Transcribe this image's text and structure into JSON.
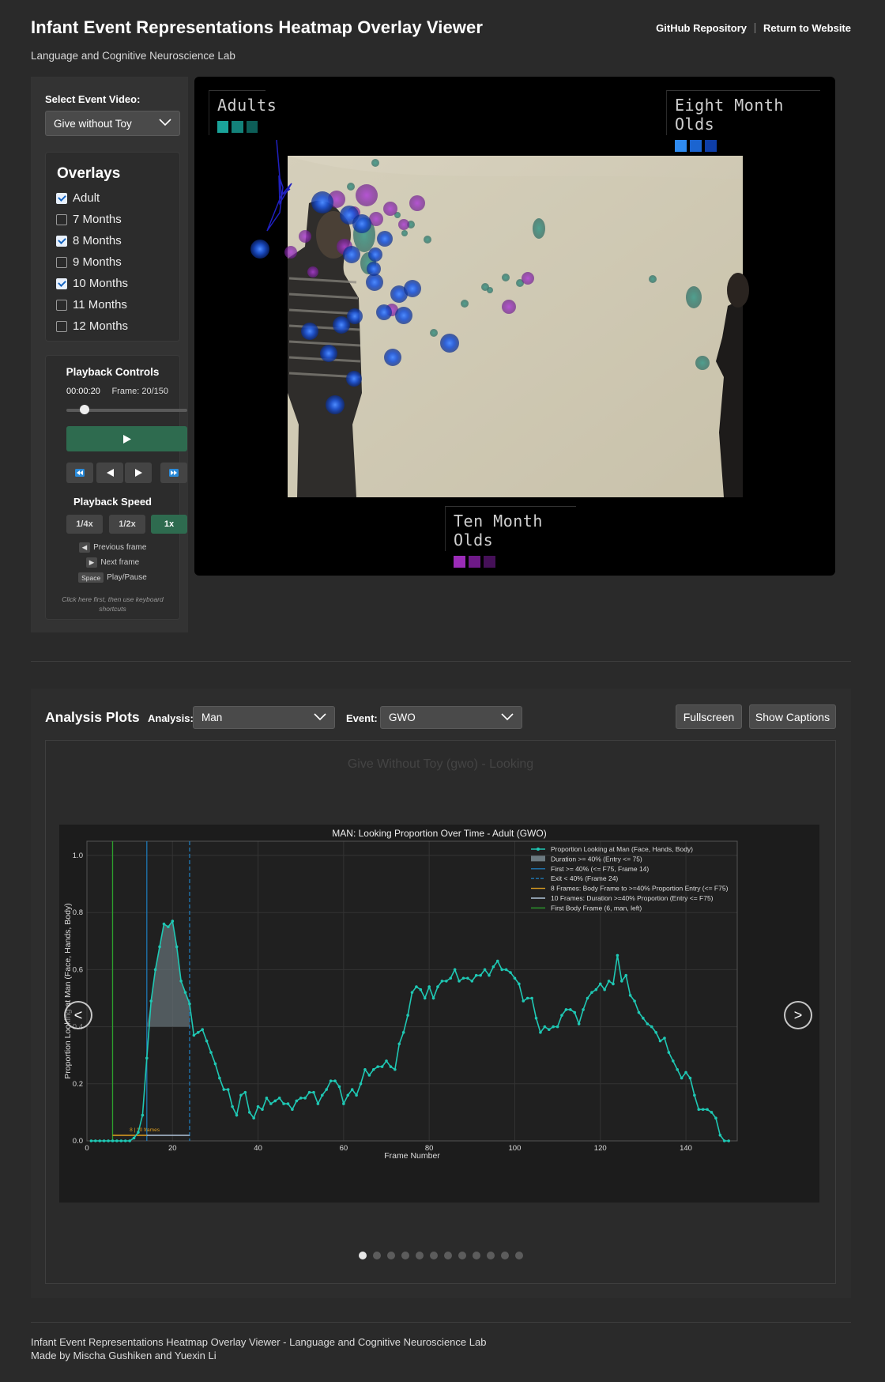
{
  "header": {
    "title": "Infant Event Representations Heatmap Overlay Viewer",
    "subtitle": "Language and Cognitive Neuroscience Lab",
    "links": [
      "GitHub Repository",
      "Return to Website"
    ]
  },
  "sidebar": {
    "select_label": "Select Event Video:",
    "selected_video": "Give without Toy",
    "overlays_title": "Overlays",
    "overlays": [
      {
        "label": "Adult",
        "checked": true
      },
      {
        "label": "7 Months",
        "checked": false
      },
      {
        "label": "8 Months",
        "checked": true
      },
      {
        "label": "9 Months",
        "checked": false
      },
      {
        "label": "10 Months",
        "checked": true
      },
      {
        "label": "11 Months",
        "checked": false
      },
      {
        "label": "12 Months",
        "checked": false
      }
    ],
    "playback": {
      "title": "Playback Controls",
      "time": "00:00:20",
      "frame": "Frame: 20/150",
      "progress": 0.133,
      "speed_title": "Playback Speed",
      "speeds": [
        "1/4x",
        "1/2x",
        "1x"
      ],
      "active_speed": "1x",
      "shortcuts": [
        {
          "key": "◀",
          "label": "Previous frame"
        },
        {
          "key": "▶",
          "label": "Next frame"
        },
        {
          "key": "Space",
          "label": "Play/Pause"
        }
      ],
      "note": "Click here first, then use keyboard shortcuts"
    }
  },
  "video": {
    "legends": [
      {
        "name": "Adults",
        "colors": [
          "#1aa39a",
          "#13827a",
          "#0d5e58"
        ]
      },
      {
        "name": "Eight Month Olds",
        "colors": [
          "#2f8bf0",
          "#1b64d0",
          "#0e3ea8"
        ]
      },
      {
        "name": "Ten Month Olds",
        "colors": [
          "#9b2cb8",
          "#6e1a88",
          "#451058"
        ]
      }
    ]
  },
  "analysis": {
    "title": "Analysis Plots",
    "analysis_label": "Analysis:",
    "analysis_value": "Man",
    "event_label": "Event:",
    "event_value": "GWO",
    "fullscreen": "Fullscreen",
    "captions": "Show Captions",
    "faded_title": "Give Without Toy (gwo) - Looking",
    "dot_count": 12,
    "active_dot": 0,
    "prev": "<",
    "next": ">"
  },
  "chart_data": {
    "type": "line",
    "title": "MAN: Looking Proportion Over Time - Adult (GWO)",
    "xlabel": "Frame Number",
    "ylabel": "Proportion Looking at Man (Face, Hands, Body)",
    "xlim": [
      0,
      152
    ],
    "ylim": [
      0,
      1.05
    ],
    "xticks": [
      0,
      20,
      40,
      60,
      80,
      100,
      120,
      140
    ],
    "yticks": [
      0.0,
      0.2,
      0.4,
      0.6,
      0.8,
      1.0
    ],
    "grid": true,
    "legend_position": "top-right",
    "legend": [
      "Proportion Looking at Man (Face, Hands, Body)",
      "Duration >= 40% (Entry <= 75)",
      "First >= 40% (<= F75, Frame 14)",
      "Exit < 40% (Frame 24)",
      "8 Frames: Body Frame to >=40% Proportion Entry (<= F75)",
      "10 Frames: Duration >=40% Proportion (Entry <= F75)",
      "First Body Frame (6, man, left)"
    ],
    "annotation": "8 | 10 frames",
    "vlines": [
      {
        "x": 6,
        "color": "#2ca02c",
        "style": "solid"
      },
      {
        "x": 14,
        "color": "#1f77b4",
        "style": "solid"
      },
      {
        "x": 24,
        "color": "#1f77b4",
        "style": "dashed"
      }
    ],
    "series": [
      {
        "name": "Proportion Looking at Man (Face, Hands, Body)",
        "x": [
          1,
          2,
          3,
          4,
          5,
          6,
          7,
          8,
          9,
          10,
          11,
          12,
          13,
          14,
          15,
          16,
          17,
          18,
          19,
          20,
          21,
          22,
          23,
          24,
          25,
          26,
          27,
          28,
          29,
          30,
          31,
          32,
          33,
          34,
          35,
          36,
          37,
          38,
          39,
          40,
          41,
          42,
          43,
          44,
          45,
          46,
          47,
          48,
          49,
          50,
          51,
          52,
          53,
          54,
          55,
          56,
          57,
          58,
          59,
          60,
          61,
          62,
          63,
          64,
          65,
          66,
          67,
          68,
          69,
          70,
          71,
          72,
          73,
          74,
          75,
          76,
          77,
          78,
          79,
          80,
          81,
          82,
          83,
          84,
          85,
          86,
          87,
          88,
          89,
          90,
          91,
          92,
          93,
          94,
          95,
          96,
          97,
          98,
          99,
          100,
          101,
          102,
          103,
          104,
          105,
          106,
          107,
          108,
          109,
          110,
          111,
          112,
          113,
          114,
          115,
          116,
          117,
          118,
          119,
          120,
          121,
          122,
          123,
          124,
          125,
          126,
          127,
          128,
          129,
          130,
          131,
          132,
          133,
          134,
          135,
          136,
          137,
          138,
          139,
          140,
          141,
          142,
          143,
          144,
          145,
          146,
          147,
          148,
          149,
          150
        ],
        "values": [
          0,
          0,
          0,
          0,
          0,
          0,
          0,
          0,
          0,
          0,
          0.01,
          0.03,
          0.09,
          0.29,
          0.49,
          0.6,
          0.68,
          0.76,
          0.75,
          0.77,
          0.68,
          0.56,
          0.52,
          0.48,
          0.37,
          0.38,
          0.39,
          0.35,
          0.31,
          0.27,
          0.22,
          0.18,
          0.18,
          0.12,
          0.09,
          0.16,
          0.17,
          0.1,
          0.08,
          0.12,
          0.11,
          0.15,
          0.13,
          0.14,
          0.15,
          0.13,
          0.13,
          0.11,
          0.14,
          0.15,
          0.15,
          0.17,
          0.17,
          0.13,
          0.16,
          0.18,
          0.21,
          0.21,
          0.19,
          0.13,
          0.16,
          0.18,
          0.16,
          0.2,
          0.25,
          0.23,
          0.25,
          0.26,
          0.26,
          0.28,
          0.26,
          0.25,
          0.34,
          0.38,
          0.44,
          0.52,
          0.54,
          0.53,
          0.5,
          0.54,
          0.5,
          0.54,
          0.56,
          0.56,
          0.57,
          0.6,
          0.56,
          0.57,
          0.57,
          0.56,
          0.58,
          0.58,
          0.6,
          0.58,
          0.61,
          0.63,
          0.6,
          0.6,
          0.59,
          0.57,
          0.55,
          0.49,
          0.5,
          0.5,
          0.43,
          0.38,
          0.4,
          0.39,
          0.4,
          0.4,
          0.44,
          0.46,
          0.46,
          0.45,
          0.41,
          0.46,
          0.5,
          0.52,
          0.53,
          0.55,
          0.53,
          0.56,
          0.55,
          0.65,
          0.56,
          0.58,
          0.51,
          0.49,
          0.45,
          0.43,
          0.41,
          0.4,
          0.38,
          0.35,
          0.36,
          0.31,
          0.28,
          0.25,
          0.22,
          0.24,
          0.22,
          0.16,
          0.11,
          0.11,
          0.11,
          0.1,
          0.08,
          0.02,
          0,
          0
        ]
      }
    ]
  },
  "footer": {
    "line1": "Infant Event Representations Heatmap Overlay Viewer - Language and Cognitive Neuroscience Lab",
    "line2": "Made by Mischa Gushiken and Yuexin Li"
  }
}
